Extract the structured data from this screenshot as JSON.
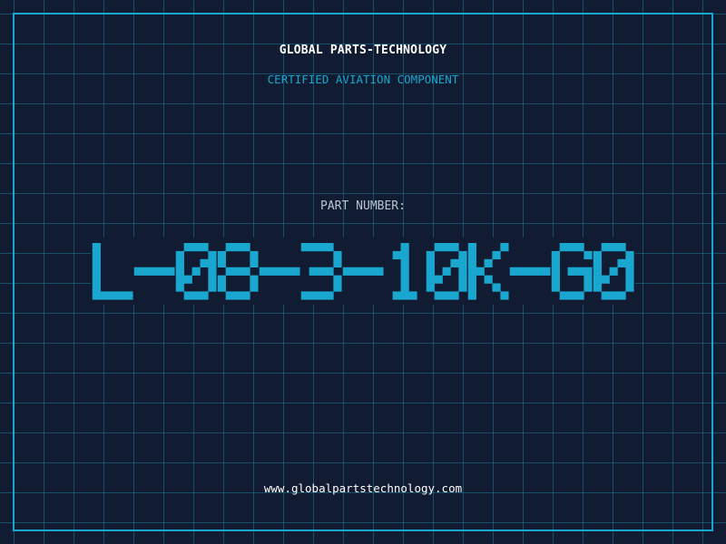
{
  "header": {
    "company": "GLOBAL PARTS-TECHNOLOGY",
    "subtitle": "CERTIFIED AVIATION COMPONENT"
  },
  "part": {
    "label": "PART NUMBER:",
    "number": "L-08-3-10K-G0"
  },
  "footer": {
    "website": "www.globalpartstechnology.com"
  },
  "colors": {
    "background": "#111b31",
    "accent": "#19a7cf",
    "grid": "#1c7896",
    "text": "#ffffff"
  }
}
